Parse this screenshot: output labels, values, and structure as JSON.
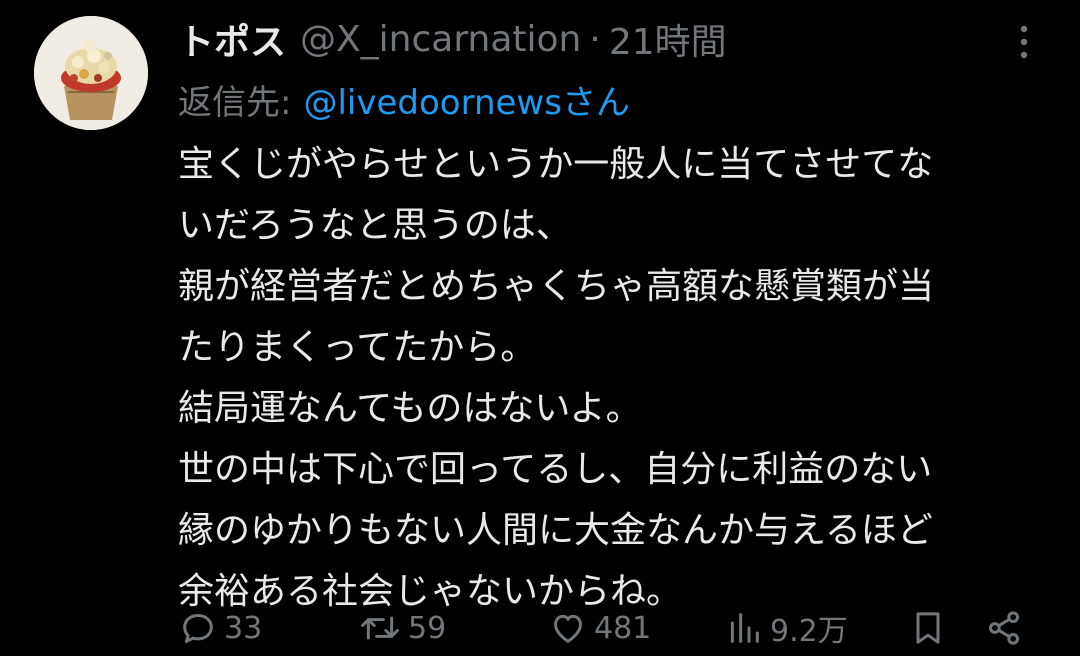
{
  "tweet": {
    "display_name": "トポス",
    "handle": "@X_incarnation",
    "separator": "·",
    "time": "21時間",
    "reply_label": "返信先:",
    "reply_user": "@livedoornewsさん",
    "body_lines": [
      "宝くじがやらせというか一般人に当てさせてな",
      "いだろうなと思うのは、",
      "親が経営者だとめちゃくちゃ高額な懸賞類が当",
      "たりまくってたから。",
      "結局運なんてものはないよ。",
      "世の中は下心で回ってるし、自分に利益のない",
      "縁のゆかりもない人間に大金なんか与えるほど",
      "余裕ある社会じゃないからね。"
    ],
    "actions": {
      "reply_count": "33",
      "retweet_count": "59",
      "like_count": "481",
      "view_count": "9.2万"
    }
  },
  "icons": {
    "more": "more-vertical-icon",
    "reply": "reply-bubble-icon",
    "retweet": "retweet-icon",
    "like": "heart-icon",
    "views": "bar-chart-icon",
    "bookmark": "bookmark-icon",
    "share": "share-icon"
  },
  "colors": {
    "background": "#000000",
    "text_primary": "#e7e9ea",
    "text_secondary": "#71767b",
    "link": "#1d9bf0"
  }
}
